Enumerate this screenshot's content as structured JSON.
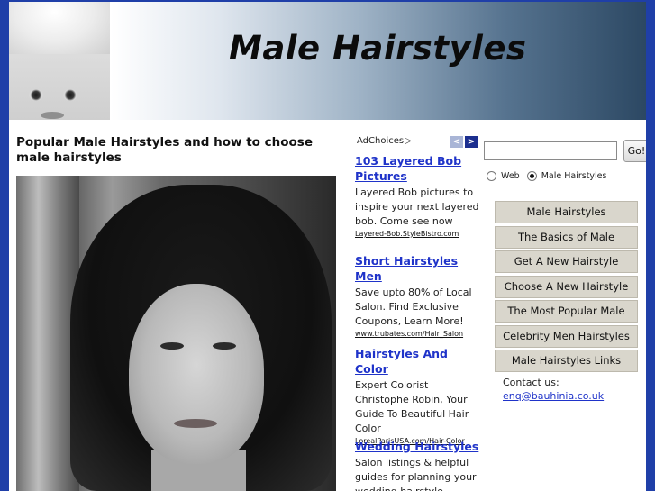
{
  "header": {
    "title": "Male Hairstyles"
  },
  "article": {
    "title": "Popular Male Hairstyles and how to choose male hairstyles"
  },
  "ads": {
    "adchoices_label": "AdChoices",
    "prev_label": "<",
    "next_label": ">",
    "items": [
      {
        "title": "103 Layered Bob Pictures",
        "desc": "Layered Bob pictures to inspire your next layered bob. Come see now",
        "url": "Layered-Bob.StyleBistro.com"
      },
      {
        "title": "Short Hairstyles Men",
        "desc": "Save upto 80% of Local Salon. Find Exclusive Coupons, Learn More!",
        "url": "www.trubates.com/Hair_Salon"
      },
      {
        "title": "Hairstyles And Color",
        "desc": "Expert Colorist Christophe Robin, Your Guide To Beautiful Hair Color",
        "url": "LorealParisUSA.com/Hair-Color"
      },
      {
        "title": "Wedding Hairstyles",
        "desc": "Salon listings & helpful guides for planning your wedding hairstyle",
        "url": ""
      }
    ]
  },
  "search": {
    "value": "",
    "go_label": "Go!",
    "options": [
      {
        "label": "Web",
        "checked": false
      },
      {
        "label": "Male Hairstyles",
        "checked": true
      }
    ]
  },
  "menu": [
    "Male Hairstyles",
    "The Basics of Male",
    "Get A New Hairstyle",
    "Choose A New Hairstyle",
    "The Most Popular Male",
    "Celebrity Men Hairstyles",
    "Male Hairstyles Links"
  ],
  "contact": {
    "label": "Contact us:",
    "email": "enq@bauhinia.co.uk"
  },
  "colors": {
    "frame": "#1f3fa8",
    "link": "#1f33c9",
    "menu_bg": "#d9d6cc"
  }
}
